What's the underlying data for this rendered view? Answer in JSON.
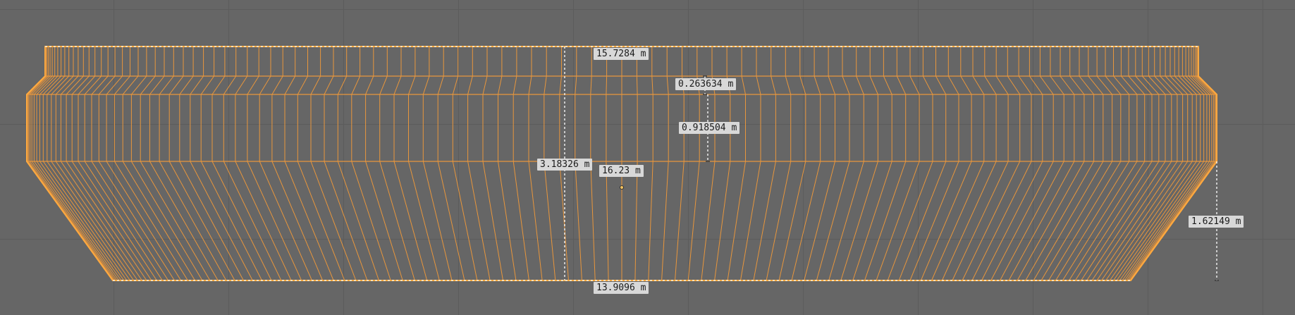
{
  "viewport": {
    "background_color": "#666666",
    "grid_color": "#5c5c5c",
    "mesh_wire_color": "#e8963c",
    "mesh_outline_color": "#ffaa40",
    "measure_color": "#ffffff"
  },
  "measurements": {
    "top_width": "15.7284 m",
    "rim_height": "0.263634 m",
    "band_height": "0.918504 m",
    "total_height": "3.18326 m",
    "center_width": "16.23 m",
    "taper_height": "1.62149 m",
    "bottom_width": "13.9096 m"
  }
}
